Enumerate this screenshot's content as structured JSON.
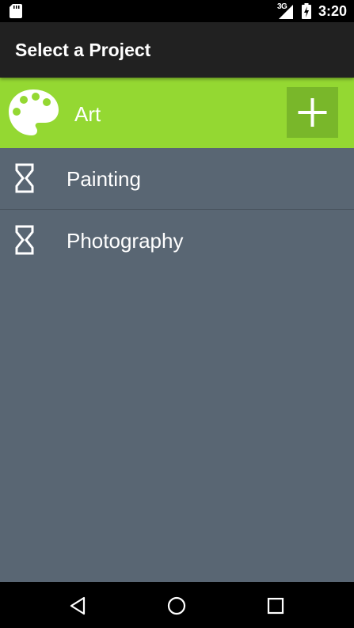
{
  "status_bar": {
    "network_type": "3G",
    "time": "3:20",
    "icons": [
      "sd-card-icon",
      "signal-icon",
      "battery-charging-icon"
    ]
  },
  "action_bar": {
    "title": "Select a Project"
  },
  "group": {
    "label": "Art",
    "icon": "palette-icon",
    "add_icon": "plus-icon"
  },
  "projects": [
    {
      "label": "Painting",
      "icon": "hourglass-icon"
    },
    {
      "label": "Photography",
      "icon": "hourglass-icon"
    }
  ],
  "nav_bar": {
    "icons": [
      "back-icon",
      "home-icon",
      "recents-icon"
    ]
  },
  "colors": {
    "status_bar": "#000000",
    "action_bar": "#212121",
    "group_header": "#94d832",
    "add_button": "#79b72a",
    "list_background": "#596673",
    "text": "#ffffff"
  }
}
